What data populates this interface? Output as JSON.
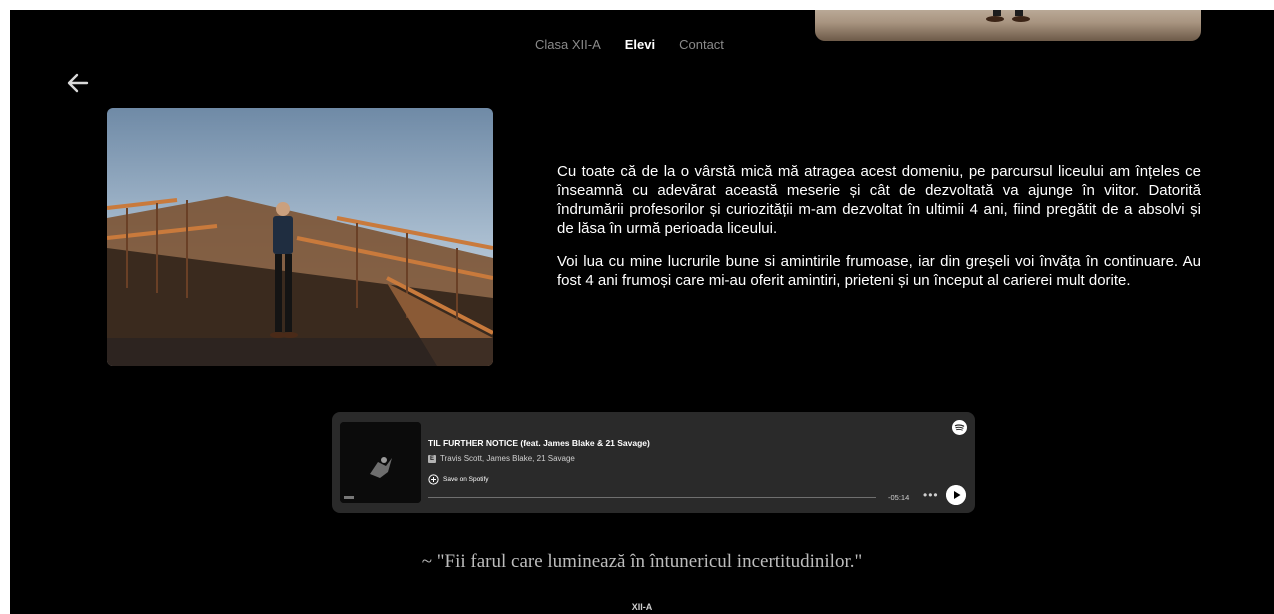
{
  "nav": {
    "items": [
      {
        "label": "Clasa XII-A",
        "active": false
      },
      {
        "label": "Elevi",
        "active": true
      },
      {
        "label": "Contact",
        "active": false
      }
    ]
  },
  "icons": {
    "back": "arrow-left-icon",
    "spotify": "spotify-logo-icon",
    "save": "plus-circle-icon",
    "more": "more-icon",
    "play": "play-icon"
  },
  "bio": {
    "paragraphs": [
      "Cu toate că de la o vârstă mică mă atragea acest domeniu, pe parcursul liceului am înțeles ce înseamnă cu adevărat această meserie și cât de dezvoltată va ajunge în viitor. Datorită îndrumării profesorilor și curiozității m-am dezvoltat în ultimii 4 ani, fiind pregătit de a absolvi și de lăsa în urmă perioada liceului.",
      "Voi lua cu mine lucrurile bune si amintirile frumoase, iar din greșeli voi învăța în continuare. Au fost 4 ani frumoși care mi-au oferit amintiri, prieteni și un început al carierei mult dorite."
    ]
  },
  "player": {
    "title": "TIL FURTHER NOTICE (feat. James Blake & 21 Savage)",
    "explicit_badge": "E",
    "artists": "Travis Scott, James Blake, 21 Savage",
    "save_label": "Save on Spotify",
    "time_remaining": "-05:14",
    "progress": 0,
    "colors": {
      "background": "#2a2a2a",
      "text": "#ffffff"
    }
  },
  "quote": "~ \"Fii farul care luminează în întunericul incertitudinilor.\"",
  "footer": "XII-A",
  "colors": {
    "page_bg": "#000000",
    "nav_inactive": "#8a8a8a",
    "nav_active": "#ffffff"
  }
}
